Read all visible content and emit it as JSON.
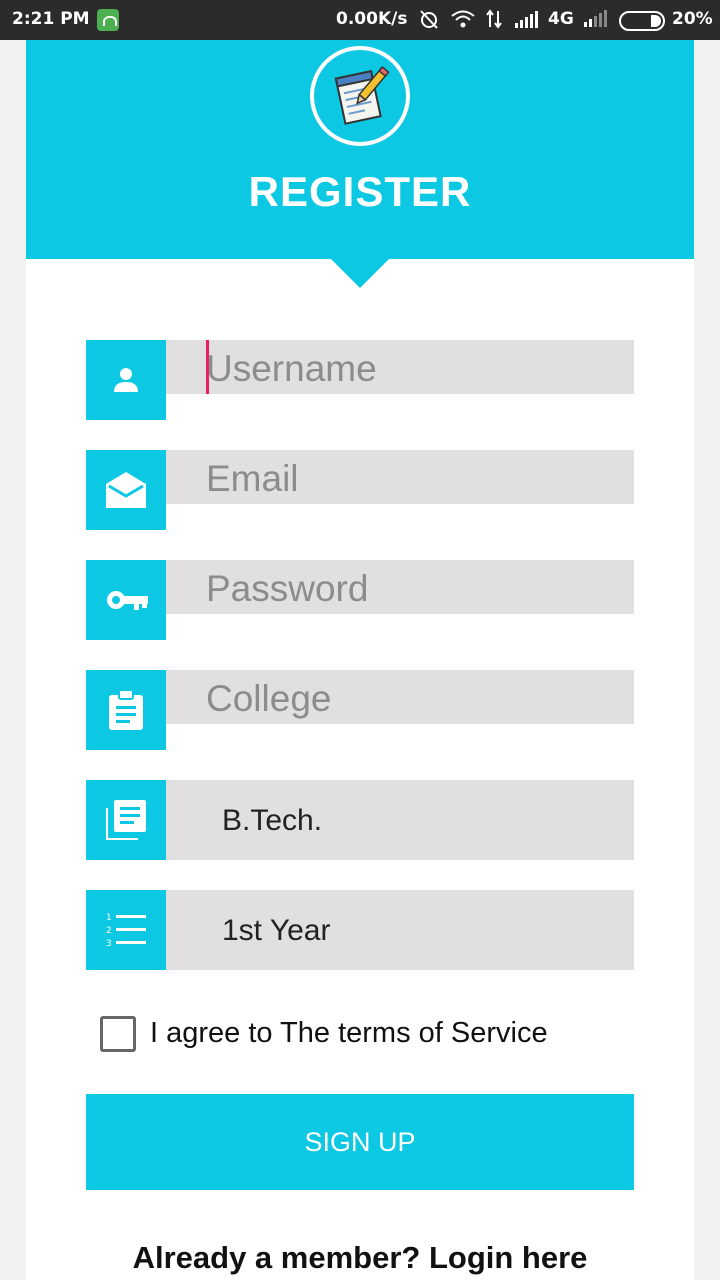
{
  "status_bar": {
    "time": "2:21 PM",
    "net_speed": "0.00K/s",
    "network": "4G",
    "battery": "20%"
  },
  "header": {
    "title": "REGISTER",
    "logo_icon": "notepad-pencil-icon"
  },
  "form": {
    "username": {
      "placeholder": "Username",
      "icon": "person-icon"
    },
    "email": {
      "placeholder": "Email",
      "icon": "envelope-open-icon"
    },
    "password": {
      "placeholder": "Password",
      "icon": "key-icon"
    },
    "college": {
      "placeholder": "College",
      "icon": "clipboard-icon"
    },
    "degree": {
      "value": "B.Tech.",
      "icon": "library-books-icon"
    },
    "year": {
      "value": "1st Year",
      "icon": "numbered-list-icon"
    }
  },
  "terms": {
    "label": "I agree to The terms of Service",
    "checked": false
  },
  "signup_label": "SIGN UP",
  "login_label": "Already a member? Login here",
  "colors": {
    "accent": "#0cc8e2",
    "field_bg": "#e1dfdf",
    "cursor": "#e91e63"
  }
}
